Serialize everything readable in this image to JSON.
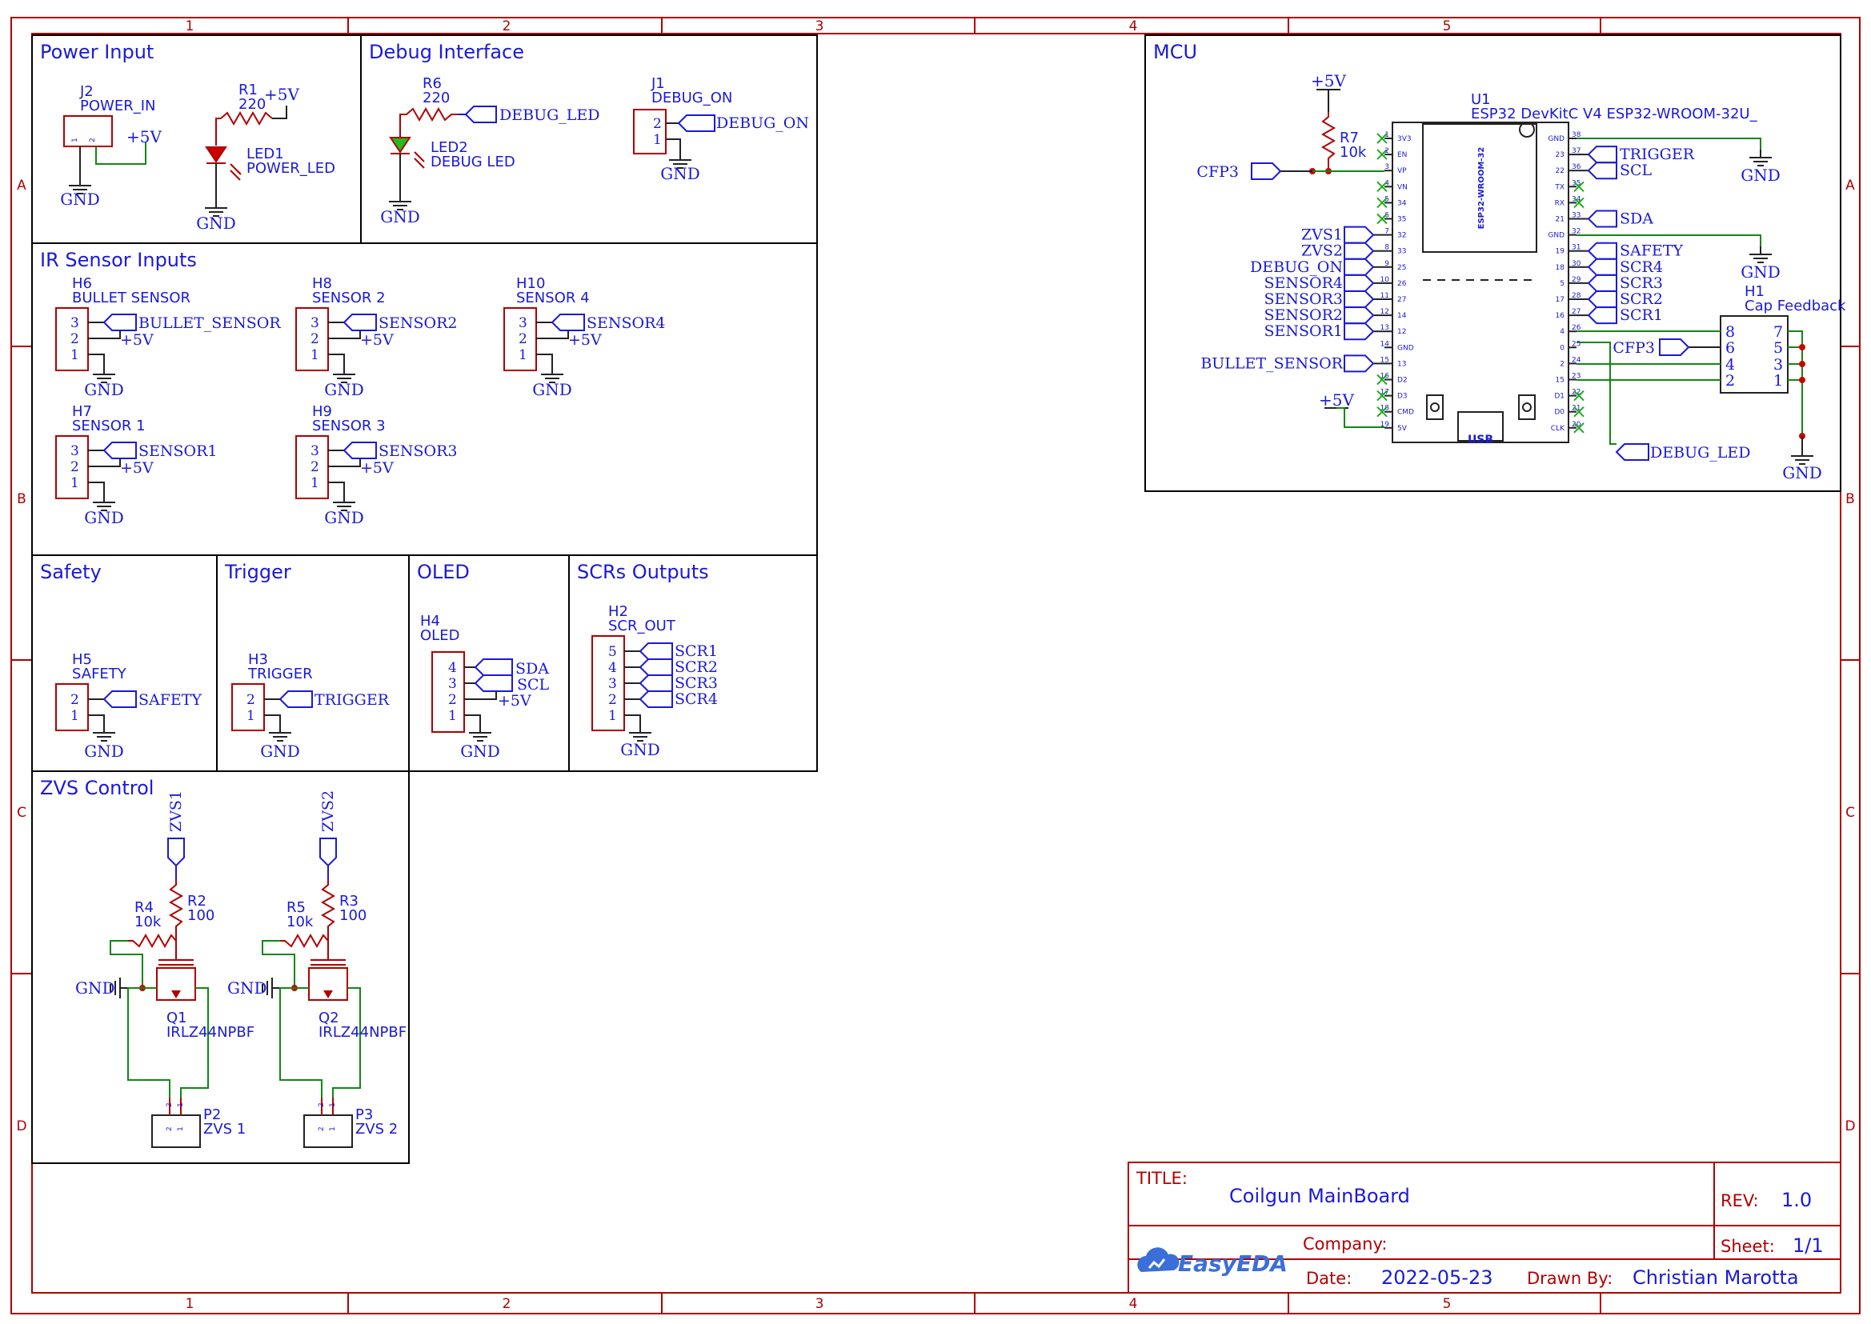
{
  "frame": {
    "columns": [
      "1",
      "2",
      "3",
      "4",
      "5"
    ],
    "rows": [
      "A",
      "B",
      "C",
      "D"
    ]
  },
  "sections": {
    "power_input": "Power Input",
    "debug_interface": "Debug Interface",
    "ir_sensor_inputs": "IR Sensor Inputs",
    "safety": "Safety",
    "trigger": "Trigger",
    "oled": "OLED",
    "scr_outputs": "SCRs Outputs",
    "zvs_control": "ZVS Control",
    "mcu": "MCU"
  },
  "power": {
    "j2_ref": "J2",
    "j2_name": "POWER_IN",
    "j2_pins": [
      "1",
      "2"
    ],
    "r1_ref": "R1",
    "r1_val": "220",
    "led1_ref": "LED1",
    "led1_name": "POWER_LED",
    "vcc": "+5V",
    "gnd": "GND"
  },
  "debug": {
    "r6_ref": "R6",
    "r6_val": "220",
    "led2_ref": "LED2",
    "led2_name": "DEBUG LED",
    "net_led": "DEBUG_LED",
    "j1_ref": "J1",
    "j1_name": "DEBUG_ON",
    "j1_pins": [
      "2",
      "1"
    ],
    "net_on": "DEBUG_ON"
  },
  "sensors": [
    {
      "ref": "H6",
      "name": "BULLET SENSOR",
      "net": "BULLET_SENSOR"
    },
    {
      "ref": "H8",
      "name": "SENSOR 2",
      "net": "SENSOR2"
    },
    {
      "ref": "H10",
      "name": "SENSOR 4",
      "net": "SENSOR4"
    },
    {
      "ref": "H7",
      "name": "SENSOR 1",
      "net": "SENSOR1"
    },
    {
      "ref": "H9",
      "name": "SENSOR 3",
      "net": "SENSOR3"
    }
  ],
  "sensor_pins": [
    "3",
    "2",
    "1"
  ],
  "safety": {
    "ref": "H5",
    "name": "SAFETY",
    "net": "SAFETY",
    "pins": [
      "2",
      "1"
    ]
  },
  "trigger": {
    "ref": "H3",
    "name": "TRIGGER",
    "net": "TRIGGER",
    "pins": [
      "2",
      "1"
    ]
  },
  "oled": {
    "ref": "H4",
    "name": "OLED",
    "pins": [
      "4",
      "3",
      "2",
      "1"
    ],
    "net_sda": "SDA",
    "net_scl": "SCL"
  },
  "scr": {
    "ref": "H2",
    "name": "SCR_OUT",
    "pins": [
      "5",
      "4",
      "3",
      "2",
      "1"
    ],
    "nets": [
      "SCR1",
      "SCR2",
      "SCR3",
      "SCR4"
    ]
  },
  "zvs": [
    {
      "net": "ZVS1",
      "rg_ref": "R2",
      "rg_val": "100",
      "rpd_ref": "R4",
      "rpd_val": "10k",
      "q_ref": "Q1",
      "q_val": "IRLZ44NPBF",
      "p_ref": "P2",
      "p_name": "ZVS 1"
    },
    {
      "net": "ZVS2",
      "rg_ref": "R3",
      "rg_val": "100",
      "rpd_ref": "R5",
      "rpd_val": "10k",
      "q_ref": "Q2",
      "q_val": "IRLZ44NPBF",
      "p_ref": "P3",
      "p_name": "ZVS 2"
    }
  ],
  "mcu": {
    "u1_ref": "U1",
    "u1_val": "ESP32 DevKitC V4 ESP32-WROOM-32U_",
    "module_label": "ESP32-WROOM-32",
    "usb": "USB",
    "r7_ref": "R7",
    "r7_val": "10k",
    "cfp3": "CFP3",
    "left_pins": [
      {
        "name": "3V3",
        "num": "1"
      },
      {
        "name": "EN",
        "num": "2"
      },
      {
        "name": "VP",
        "num": "3"
      },
      {
        "name": "VN",
        "num": "4"
      },
      {
        "name": "34",
        "num": "5"
      },
      {
        "name": "35",
        "num": "6"
      },
      {
        "name": "32",
        "num": "7"
      },
      {
        "name": "33",
        "num": "8"
      },
      {
        "name": "25",
        "num": "9"
      },
      {
        "name": "26",
        "num": "10"
      },
      {
        "name": "27",
        "num": "11"
      },
      {
        "name": "14",
        "num": "12"
      },
      {
        "name": "12",
        "num": "13"
      },
      {
        "name": "GND",
        "num": "14"
      },
      {
        "name": "13",
        "num": "15"
      },
      {
        "name": "D2",
        "num": "16"
      },
      {
        "name": "D3",
        "num": "17"
      },
      {
        "name": "CMD",
        "num": "18"
      },
      {
        "name": "5V",
        "num": "19"
      }
    ],
    "right_pins": [
      {
        "name": "GND",
        "num": "38"
      },
      {
        "name": "23",
        "num": "37"
      },
      {
        "name": "22",
        "num": "36"
      },
      {
        "name": "TX",
        "num": "35"
      },
      {
        "name": "RX",
        "num": "34"
      },
      {
        "name": "21",
        "num": "33"
      },
      {
        "name": "GND",
        "num": "32"
      },
      {
        "name": "19",
        "num": "31"
      },
      {
        "name": "18",
        "num": "30"
      },
      {
        "name": "5",
        "num": "29"
      },
      {
        "name": "17",
        "num": "28"
      },
      {
        "name": "16",
        "num": "27"
      },
      {
        "name": "4",
        "num": "26"
      },
      {
        "name": "0",
        "num": "25"
      },
      {
        "name": "2",
        "num": "24"
      },
      {
        "name": "15",
        "num": "23"
      },
      {
        "name": "D1",
        "num": "22"
      },
      {
        "name": "D0",
        "num": "21"
      },
      {
        "name": "CLK",
        "num": "20"
      }
    ],
    "left_nets": [
      {
        "pin": 6,
        "net": "ZVS1"
      },
      {
        "pin": 7,
        "net": "ZVS2"
      },
      {
        "pin": 8,
        "net": "DEBUG_ON"
      },
      {
        "pin": 9,
        "net": "SENSOR4"
      },
      {
        "pin": 10,
        "net": "SENSOR3"
      },
      {
        "pin": 11,
        "net": "SENSOR2"
      },
      {
        "pin": 12,
        "net": "SENSOR1"
      },
      {
        "pin": 14,
        "net": "BULLET_SENSOR"
      }
    ],
    "right_nets": [
      {
        "pin": 1,
        "net": "TRIGGER"
      },
      {
        "pin": 2,
        "net": "SCL"
      },
      {
        "pin": 5,
        "net": "SDA"
      },
      {
        "pin": 7,
        "net": "SAFETY"
      },
      {
        "pin": 8,
        "net": "SCR4"
      },
      {
        "pin": 9,
        "net": "SCR3"
      },
      {
        "pin": 10,
        "net": "SCR2"
      },
      {
        "pin": 11,
        "net": "SCR1"
      }
    ],
    "debug_led_net": "DEBUG_LED",
    "h1_ref": "H1",
    "h1_name": "Cap Feedback",
    "h1_left_pins": [
      "8",
      "6",
      "4",
      "2"
    ],
    "h1_right_pins": [
      "7",
      "5",
      "3",
      "1"
    ]
  },
  "title_block": {
    "title_label": "TITLE:",
    "title": "Coilgun MainBoard",
    "rev_label": "REV:",
    "rev": "1.0",
    "company_label": "Company:",
    "sheet_label": "Sheet:",
    "sheet": "1/1",
    "date_label": "Date:",
    "date": "2022-05-23",
    "drawn_label": "Drawn By:",
    "drawn": "Christian Marotta",
    "logo": "EasyEDA"
  }
}
